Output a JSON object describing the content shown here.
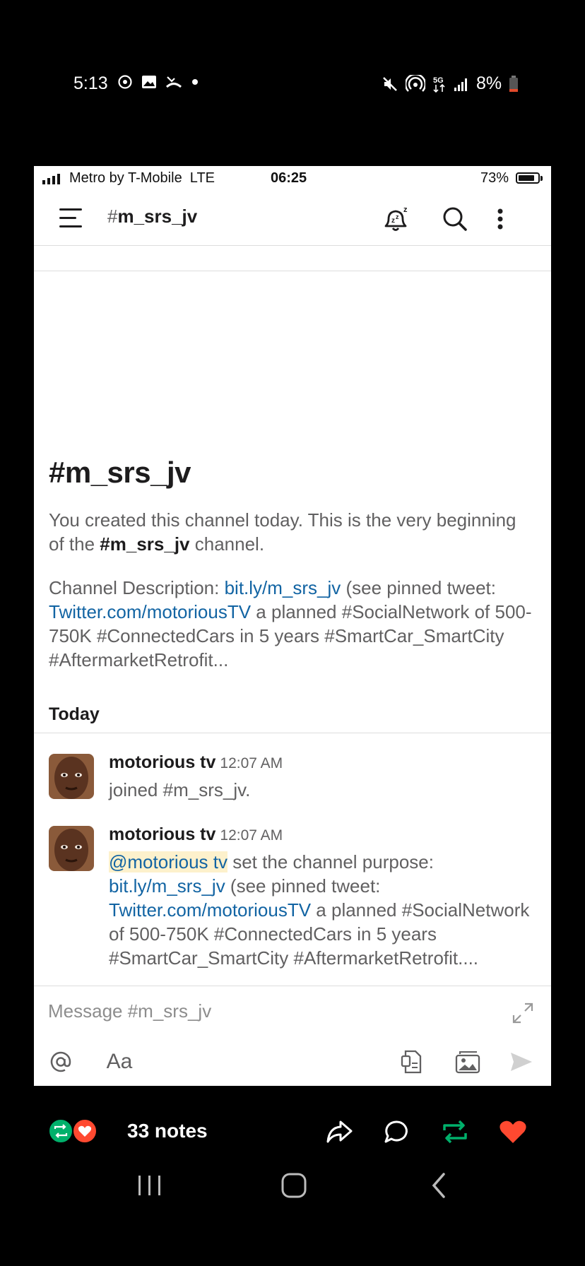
{
  "os_status": {
    "time": "5:13",
    "left_icons": [
      "whatsapp-icon",
      "gallery-icon",
      "missed-call-icon",
      "dot-icon"
    ],
    "right_icons": [
      "mute-icon",
      "hotspot-icon",
      "5g-icon",
      "signal-icon"
    ],
    "battery": "8%"
  },
  "ios_status": {
    "carrier": "Metro by T-Mobile  LTE",
    "time": "06:25",
    "battery": "73%"
  },
  "header": {
    "hash": "#",
    "channel": "m_srs_jv",
    "icons": [
      "menu-icon",
      "snooze-bell-icon",
      "search-icon",
      "more-vertical-icon"
    ]
  },
  "channel": {
    "heading": "#m_srs_jv",
    "intro_pre": "You created this channel today. This is the very beginning of the ",
    "intro_bold": "#m_srs_jv",
    "intro_post": " channel.",
    "desc_label": "Channel Description: ",
    "desc_link1": "bit.ly/m_srs_jv",
    "desc_mid": " (see pinned tweet: ",
    "desc_link2": "Twitter.com/motoriousTV",
    "desc_rest": " a planned #SocialNetwork of 500-750K #ConnectedCars in 5 years #SmartCar_SmartCity #AftermarketRetrofit..."
  },
  "day_label": "Today",
  "messages": [
    {
      "author": "motorious tv",
      "time": "12:07 AM",
      "text": "joined #m_srs_jv."
    },
    {
      "author": "motorious tv",
      "time": "12:07 AM",
      "mention": "@motorious tv",
      "text_pre": " set the channel purpose: ",
      "link1": "bit.ly/m_srs_jv",
      "text_mid": " (see pinned tweet: ",
      "link2": "Twitter.com/motoriousTV",
      "text_rest": " a planned #SocialNetwork of 500-750K #ConnectedCars in 5 years #SmartCar_SmartCity #AftermarketRetrofit...."
    }
  ],
  "composer": {
    "placeholder": "Message #m_srs_jv",
    "format_label": "Aa",
    "icons": [
      "expand-icon",
      "at-icon",
      "attach-file-icon",
      "photo-icon",
      "send-icon"
    ]
  },
  "tumblr_bar": {
    "notes": "33 notes",
    "icons": [
      "share-icon",
      "reply-icon",
      "reblog-icon",
      "like-icon"
    ],
    "colors": {
      "reblog": "#00b06b",
      "like": "#ff4930"
    }
  },
  "android_nav": [
    "recents-icon",
    "home-icon",
    "back-icon"
  ]
}
